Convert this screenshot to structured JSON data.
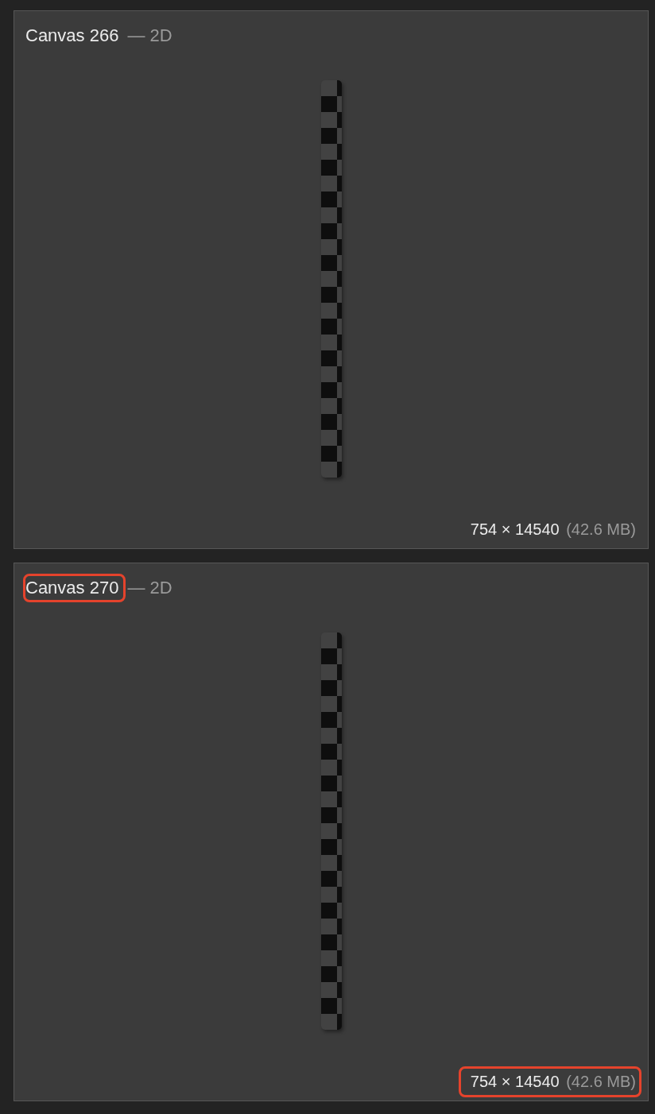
{
  "canvases": [
    {
      "title": "Canvas 266",
      "type": "— 2D",
      "dimensions": "754 × 14540",
      "memory": "(42.6 MB)",
      "title_highlighted": false,
      "size_highlighted": false
    },
    {
      "title": "Canvas 270",
      "type": "— 2D",
      "dimensions": "754 × 14540",
      "memory": "(42.6 MB)",
      "title_highlighted": true,
      "size_highlighted": true
    }
  ]
}
